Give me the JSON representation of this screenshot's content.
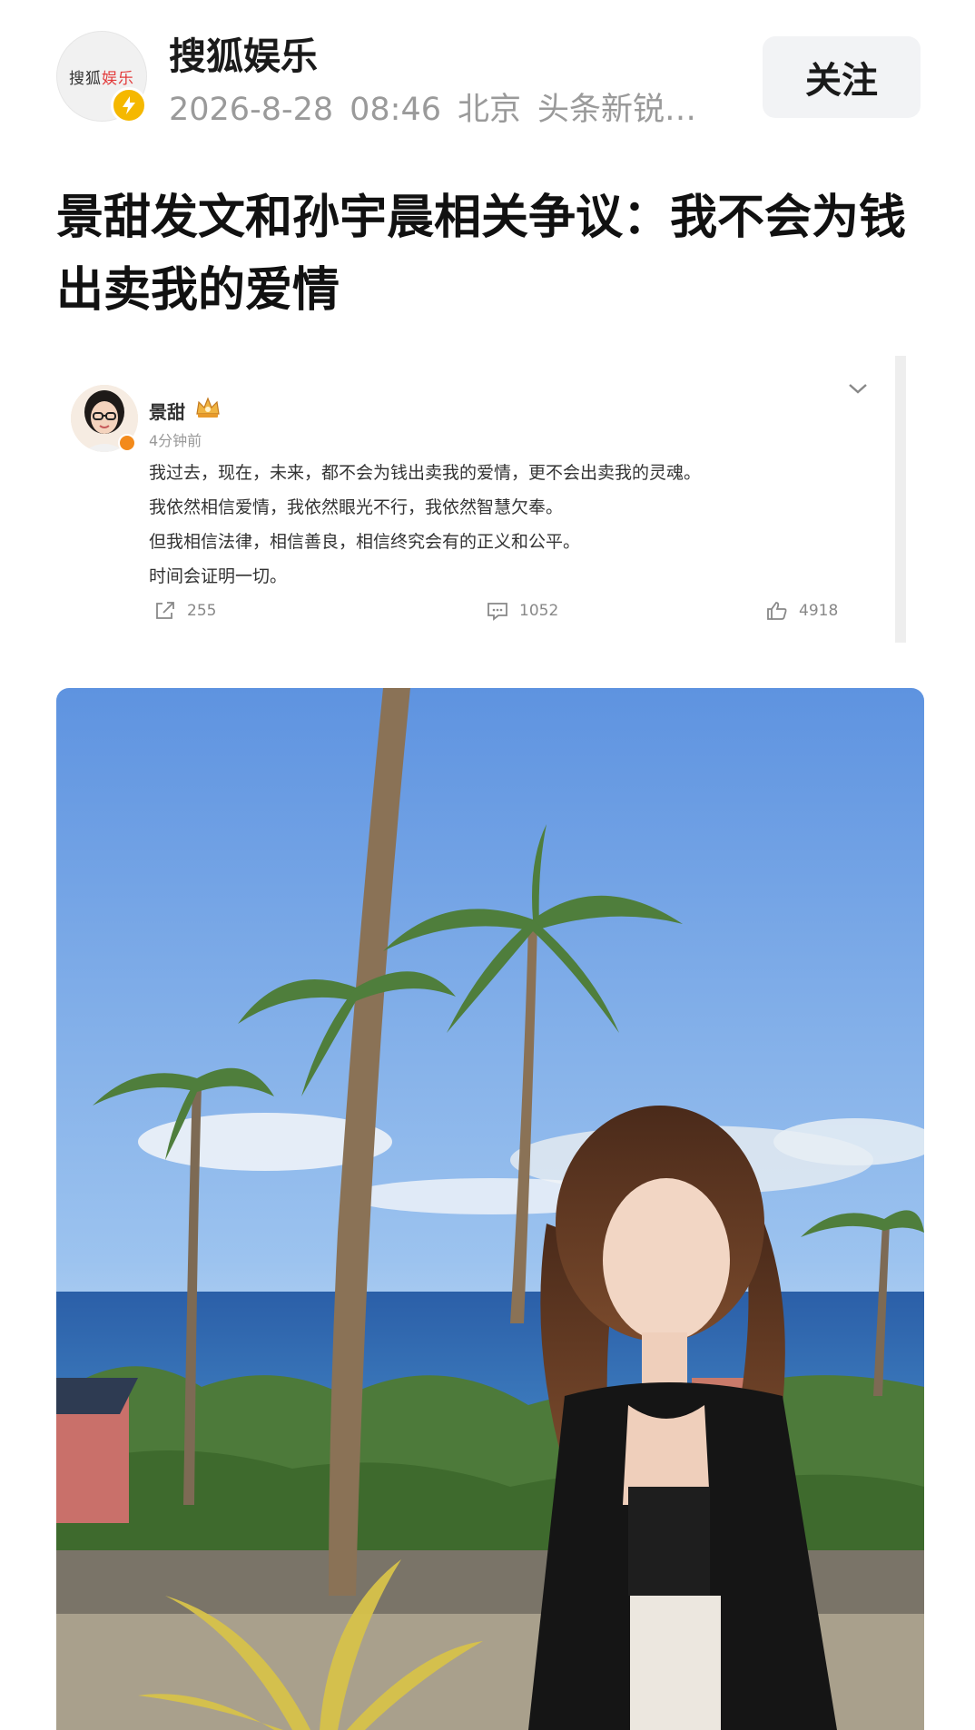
{
  "header": {
    "avatar_text_main": "搜狐",
    "avatar_text_accent": "娱乐",
    "source_name": "搜狐娱乐",
    "date": "2026-8-28",
    "time": "08:46",
    "location": "北京",
    "tag": "头条新锐…",
    "follow_label": "关注",
    "avatar_badge_icon": "lightning-icon",
    "badge_color": "#f5b800"
  },
  "article": {
    "title": "景甜发文和孙宇晨相关争议：我不会为钱出卖我的爱情"
  },
  "weibo_post": {
    "user": "景甜",
    "time_ago": "4分钟前",
    "lines": [
      "我过去，现在，未来，都不会为钱出卖我的爱情，更不会出卖我的灵魂。",
      "我依然相信爱情，我依然眼光不行，我依然智慧欠奉。",
      "但我相信法律，相信善良，相信终究会有的正义和公平。",
      "时间会证明一切。"
    ],
    "reposts": "255",
    "comments": "1052",
    "likes": "4918",
    "icons": {
      "repost": "share-icon",
      "comment": "comment-icon",
      "like": "thumbs-up-icon",
      "menu": "chevron-down-icon",
      "verified": "crown-icon"
    }
  },
  "photo": {
    "subject": "woman-by-palm-trees-photo"
  }
}
